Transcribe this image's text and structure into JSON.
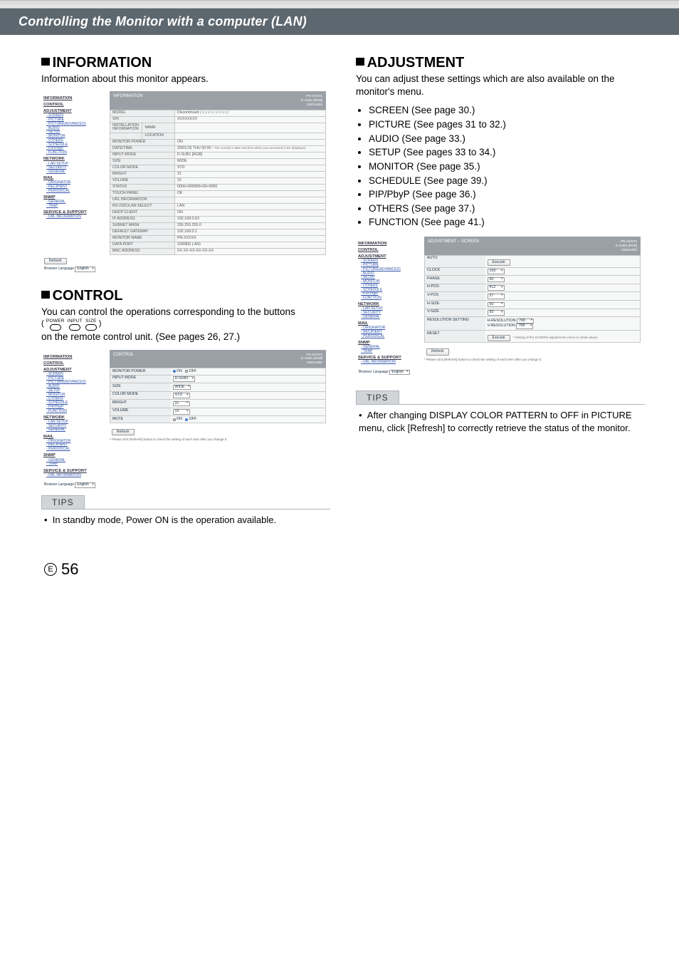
{
  "title_band": "Controlling the Monitor with a computer (LAN)",
  "left": {
    "info_h": "INFORMATION",
    "info_sub": "Information about this monitor appears.",
    "control_h": "CONTROL",
    "control_sub_pre": "You can control the operations corresponding to the buttons",
    "control_sub_post": " on the remote control unit. (See pages 26, 27.)",
    "btn1": "POWER",
    "btn2": "INPUT",
    "btn3": "SIZE",
    "tips_h": "TIPS",
    "tips_body": "In standby mode, Power ON is the operation available."
  },
  "right": {
    "adj_h": "ADJUSTMENT",
    "adj_sub": "You can adjust these settings which are also available on the monitor's menu.",
    "bullets": [
      "SCREEN (See page 30.)",
      "PICTURE (See pages 31 to 32.)",
      "AUDIO (See page 33.)",
      "SETUP (See pages 33 to 34.)",
      "MONITOR (See page 35.)",
      "SCHEDULE (See page 39.)",
      "PIP/PbyP (See page 36.)",
      "OTHERS (See page 37.)",
      "FUNCTION (See page 41.)"
    ],
    "tips_h": "TIPS",
    "tips_body": "After changing DISPLAY COLOR PATTERN to OFF in PICTURE menu, click [Refresh] to correctly retrieve the status of the monitor."
  },
  "sidebar": {
    "groups": [
      {
        "title": "INFORMATION",
        "links": []
      },
      {
        "title": "CONTROL",
        "links": []
      },
      {
        "title": "ADJUSTMENT",
        "links": [
          "SCREEN",
          "PICTURE",
          "PICTURE(ADVANCED)",
          "AUDIO",
          "SETUP",
          "MONITOR",
          "OTHERS",
          "SCHEDULE",
          "PIP/PbyP",
          "FUNCTION"
        ]
      },
      {
        "title": "NETWORK",
        "links": [
          "LAN SETUP",
          "SECURITY",
          "GENERAL"
        ]
      },
      {
        "title": "MAIL",
        "links": [
          "ORIGINATOR",
          "RECIPIENT",
          "PERIODICAL"
        ]
      },
      {
        "title": "SNMP",
        "links": [
          "GENERAL",
          "TRAP"
        ]
      },
      {
        "title": "SERVICE & SUPPORT",
        "links": [
          "URL INFORMATION"
        ]
      }
    ],
    "lang_label": "Browser Language",
    "lang_value": "English"
  },
  "info_panel": {
    "header": "INFORMATION",
    "badge1": "PN-XXXXX",
    "badge2": "D-SUB1 [RGB]",
    "badge3": "1920x1080",
    "rows": [
      [
        "MODEL",
        "",
        "Discontinued",
        "[ X X X X / X X X X ]"
      ],
      [
        "S/N",
        "",
        "XXXXXXXX",
        ""
      ],
      [
        "INSTALLATION INFORMATION",
        "NAME",
        "",
        ""
      ],
      [
        "",
        "LOCATION",
        "",
        ""
      ],
      [
        "MONITOR POWER",
        "",
        "ON",
        ""
      ],
      [
        "DATE/TIME",
        "",
        "20/01/15 THU 00:00",
        " * The monitor's date and time when you accessed it are displayed."
      ],
      [
        "INPUT MODE",
        "",
        "D-SUB1 [RGB]",
        ""
      ],
      [
        "SIZE",
        "",
        "WIDE",
        ""
      ],
      [
        "COLOR MODE",
        "",
        "STD",
        ""
      ],
      [
        "BRIGHT",
        "",
        "31",
        ""
      ],
      [
        "VOLUME",
        "",
        "15",
        ""
      ],
      [
        "STATUS",
        "",
        "0000+000000+00+0000",
        ""
      ],
      [
        "TOUCH PANEL",
        "",
        "OK",
        ""
      ],
      [
        "URL INFORMATION",
        "",
        "",
        ""
      ],
      [
        "RS-232C/LAN SELECT",
        "",
        "LAN",
        ""
      ],
      [
        "DHCP CLIENT",
        "",
        "ON",
        ""
      ],
      [
        "IP ADDRESS",
        "",
        "192.168.0.63",
        ""
      ],
      [
        "SUBNET MASK",
        "",
        "255.255.255.0",
        ""
      ],
      [
        "DEFAULT GATEWAY",
        "",
        "192.168.0.1",
        ""
      ],
      [
        "MONITOR NAME",
        "",
        "PN-XXXXX",
        ""
      ],
      [
        "DATA PORT",
        "",
        "10008(0 LAN)",
        ""
      ],
      [
        "MAC ADDRESS",
        "",
        "XX-XX-XX-XX-XX-XX",
        ""
      ]
    ],
    "refresh": "Refresh"
  },
  "control_panel": {
    "header": "CONTROL",
    "badge1": "PN-XXXXX",
    "badge2": "D-SUB1 [RGB]",
    "badge3": "1920x1080",
    "rows": [
      {
        "k": "MONITOR POWER",
        "type": "radio",
        "on": "ON",
        "off": "OFF",
        "state": "on"
      },
      {
        "k": "INPUT MODE",
        "type": "select",
        "v": "D-SUB1"
      },
      {
        "k": "SIZE",
        "type": "select",
        "v": "WIDE"
      },
      {
        "k": "COLOR MODE",
        "type": "select",
        "v": "STD"
      },
      {
        "k": "BRIGHT",
        "type": "select",
        "v": "31"
      },
      {
        "k": "VOLUME",
        "type": "select",
        "v": "15"
      },
      {
        "k": "MUTE",
        "type": "radio",
        "on": "ON",
        "off": "OFF",
        "state": "off"
      }
    ],
    "refresh": "Refresh",
    "note": "* Please click [Refresh] button to check the setting of each item after you change it."
  },
  "adj_panel": {
    "header": "ADJUSTMENT – SCREEN",
    "badge1": "PN-XXXXX",
    "badge2": "D-SUB1 [RGB]",
    "badge3": "1920x1080",
    "rows": [
      {
        "k": "AUTO",
        "type": "btn",
        "v": "Execute"
      },
      {
        "k": "CLOCK",
        "type": "select",
        "v": "100"
      },
      {
        "k": "PHASE",
        "type": "select",
        "v": "50"
      },
      {
        "k": "H-POS",
        "type": "select",
        "v": "412"
      },
      {
        "k": "V-POS",
        "type": "select",
        "v": "37"
      },
      {
        "k": "H-SIZE",
        "type": "select",
        "v": "50"
      },
      {
        "k": "V-SIZE",
        "type": "select",
        "v": "50"
      },
      {
        "k": "RESOLUTION SETTING",
        "type": "res",
        "a": "H-RESOLUTION",
        "av": "768",
        "b": "V-RESOLUTION",
        "bv": "768"
      },
      {
        "k": "RESET",
        "type": "btn2",
        "v": "Execute",
        "note": "* Setting of the SCREEN adjustments return to initial values."
      }
    ],
    "refresh": "Refresh",
    "note": "* Please click [Refresh] button to check the setting of each item after you change it."
  },
  "footer": {
    "e": "E",
    "page": "56"
  }
}
